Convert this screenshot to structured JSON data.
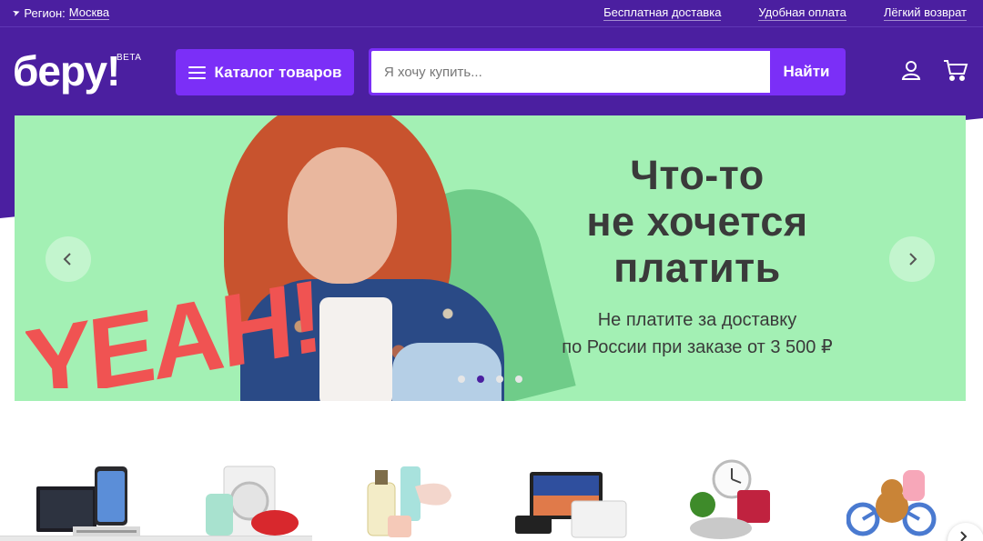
{
  "topbar": {
    "region_label": "Регион:",
    "region_city": "Москва",
    "links": [
      "Бесплатная доставка",
      "Удобная оплата",
      "Лёгкий возврат"
    ]
  },
  "header": {
    "logo": "беру!",
    "beta": "BETA",
    "catalog_label": "Каталог товаров",
    "search_placeholder": "Я хочу купить...",
    "search_button": "Найти"
  },
  "banner": {
    "yeah_text": "YEAH!",
    "headline": [
      "Что-то",
      "не хочется",
      "платить"
    ],
    "subline": [
      "Не платите за доставку",
      "по России при заказе от 3 500 ₽"
    ],
    "slides_count": 4,
    "active_slide": 2
  },
  "categories": [
    {
      "icon": "electronics-icon"
    },
    {
      "icon": "appliances-icon"
    },
    {
      "icon": "beauty-icon"
    },
    {
      "icon": "computers-icon"
    },
    {
      "icon": "home-kitchen-icon"
    },
    {
      "icon": "kids-icon"
    }
  ],
  "colors": {
    "brand_purple": "#4b1fa0",
    "accent_violet": "#7b2ff7",
    "banner_green": "#a3f0b4",
    "yeah_red": "#f05352"
  }
}
